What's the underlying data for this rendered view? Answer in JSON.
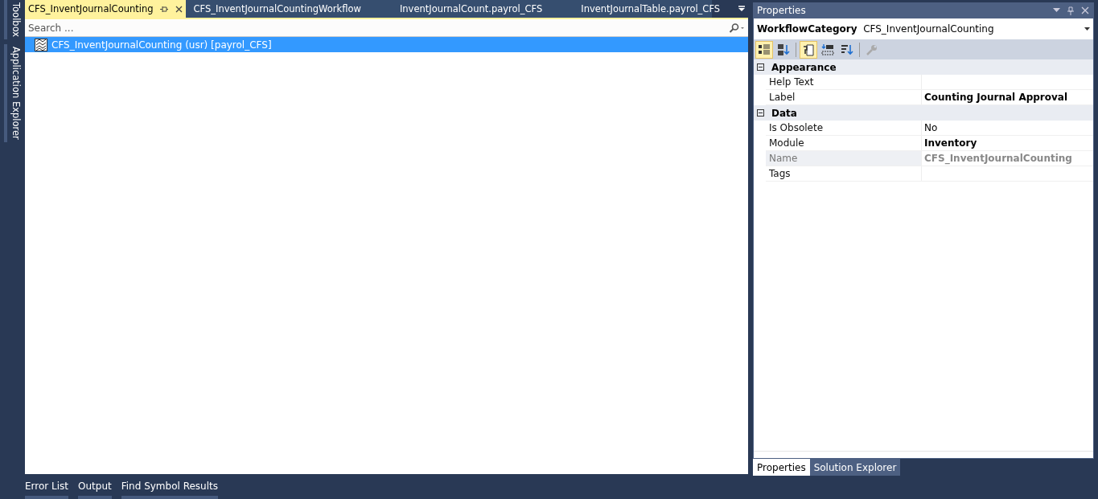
{
  "side_tabs": [
    {
      "label": "Toolbox"
    },
    {
      "label": "Application Explorer"
    }
  ],
  "editor": {
    "tabs": [
      {
        "label": "CFS_InventJournalCounting",
        "selected": true
      },
      {
        "label": "CFS_InventJournalCountingWorkflow",
        "selected": false
      },
      {
        "label": "InventJournalCount.payrol_CFS",
        "selected": false
      },
      {
        "label": "InventJournalTable.payrol_CFS",
        "selected": false
      }
    ],
    "search": {
      "placeholder": "Search ..."
    },
    "tree": [
      {
        "label": "CFS_InventJournalCounting (usr) [payrol_CFS]",
        "selected": true
      }
    ]
  },
  "properties": {
    "title": "Properties",
    "object_type": "WorkflowCategory",
    "object_name": "CFS_InventJournalCounting",
    "toolbar": [
      {
        "kind": "categorized",
        "selected": true
      },
      {
        "kind": "alphabetical",
        "selected": false
      },
      {
        "kind": "properties",
        "selected": true
      },
      {
        "kind": "events",
        "selected": false
      },
      {
        "kind": "sort",
        "selected": false
      },
      {
        "kind": "wrench",
        "selected": false
      }
    ],
    "groups": [
      {
        "name": "Appearance",
        "expanded": true,
        "rows": [
          {
            "name": "Help Text",
            "readonly": false
          },
          {
            "name": "Label",
            "value": "Counting Journal Approval",
            "modified": true,
            "readonly": false
          }
        ]
      },
      {
        "name": "Data",
        "expanded": true,
        "rows": [
          {
            "name": "Is Obsolete",
            "value": "No",
            "modified": false,
            "readonly": false
          },
          {
            "name": "Module",
            "value": "Inventory",
            "modified": true,
            "readonly": false
          },
          {
            "name": "Name",
            "value": "CFS_InventJournalCounting",
            "modified": true,
            "readonly": true
          },
          {
            "name": "Tags",
            "readonly": false
          }
        ]
      }
    ],
    "tabs": [
      {
        "label": "Properties",
        "selected": true
      },
      {
        "label": "Solution Explorer",
        "selected": false
      }
    ]
  },
  "bottom_tabs": [
    {
      "label": "Error List"
    },
    {
      "label": "Output"
    },
    {
      "label": "Find Symbol Results"
    }
  ]
}
